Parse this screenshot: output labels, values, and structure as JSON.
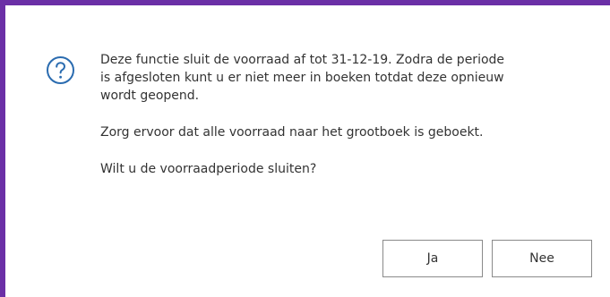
{
  "dialog": {
    "icon": "question-circle-icon",
    "accent_color": "#6b2fa6",
    "message_lines": [
      "Deze functie sluit de voorraad af tot 31-12-19. Zodra de periode",
      "is afgesloten kunt u er niet meer in boeken totdat deze opnieuw",
      "wordt geopend."
    ],
    "reminder": "Zorg ervoor dat alle voorraad naar het grootboek is geboekt.",
    "question": "Wilt u de voorraadperiode sluiten?",
    "buttons": {
      "yes_label": "Ja",
      "no_label": "Nee"
    }
  }
}
